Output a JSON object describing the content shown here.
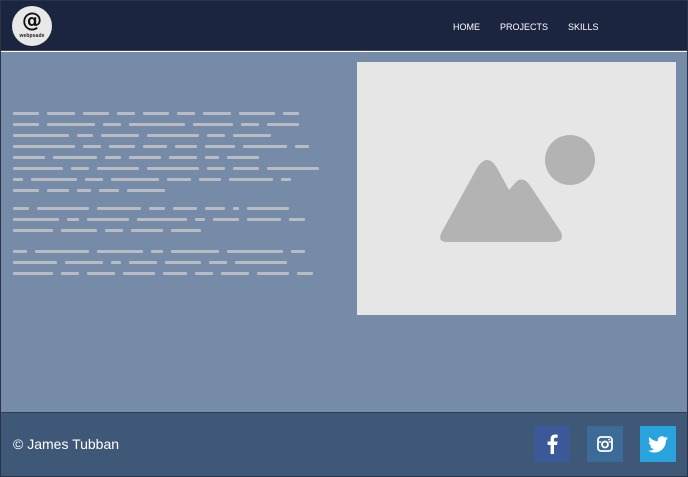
{
  "header": {
    "logo_symbol": "@",
    "logo_text": "webpsade",
    "nav": [
      {
        "label": "HOME",
        "icon": null
      },
      {
        "label": "PROJECTS",
        "icon": null
      },
      {
        "label": "SKILLS",
        "icon": null
      }
    ]
  },
  "hero": {
    "text_placeholder": "greeked-text-lines",
    "image_placeholder_icon": "image-placeholder-icon"
  },
  "footer": {
    "copyright": "© James Tubban",
    "social": [
      {
        "name": "facebook",
        "icon": "facebook-icon",
        "color": "#3b5998"
      },
      {
        "name": "instagram",
        "icon": "instagram-icon",
        "color": "#3d6b98"
      },
      {
        "name": "twitter",
        "icon": "twitter-icon",
        "color": "#29a3de"
      }
    ]
  },
  "colors": {
    "header_bg": "#1c2540",
    "hero_bg": "#758ba8",
    "footer_bg": "#3f5878",
    "placeholder_bg": "#e6e6e6",
    "placeholder_shape": "#b3b3b3"
  }
}
